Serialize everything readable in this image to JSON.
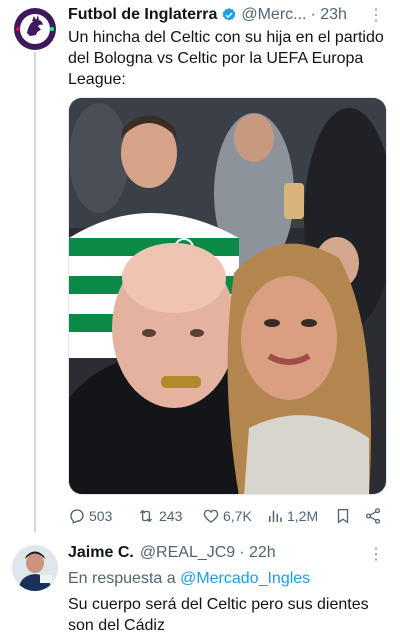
{
  "tweet1": {
    "display_name": "Futbol de Inglaterra",
    "handle": "@Merc...",
    "time": "· 23h",
    "text": "Un hincha del Celtic con su hija en el partido del Bologna vs Celtic por la UEFA Europa League:",
    "counts": {
      "replies": "503",
      "retweets": "243",
      "likes": "6,7K",
      "views": "1,2M"
    }
  },
  "tweet2": {
    "display_name": "Jaime C.",
    "handle": "@REAL_JC9",
    "time": "· 22h",
    "reply_prefix": "En respuesta a",
    "reply_to": "@Mercado_Ingles",
    "text": "Su cuerpo será del Celtic pero sus dientes son del Cádiz"
  },
  "colors": {
    "accent": "#1d9bf0",
    "text": "#0f1419",
    "muted": "#536471",
    "celtic_green": "#0b8a47"
  },
  "icons": [
    "premier-league-logo",
    "verified-badge-icon",
    "more-icon",
    "reply-icon",
    "retweet-icon",
    "like-icon",
    "views-icon",
    "bookmark-icon",
    "share-icon"
  ]
}
